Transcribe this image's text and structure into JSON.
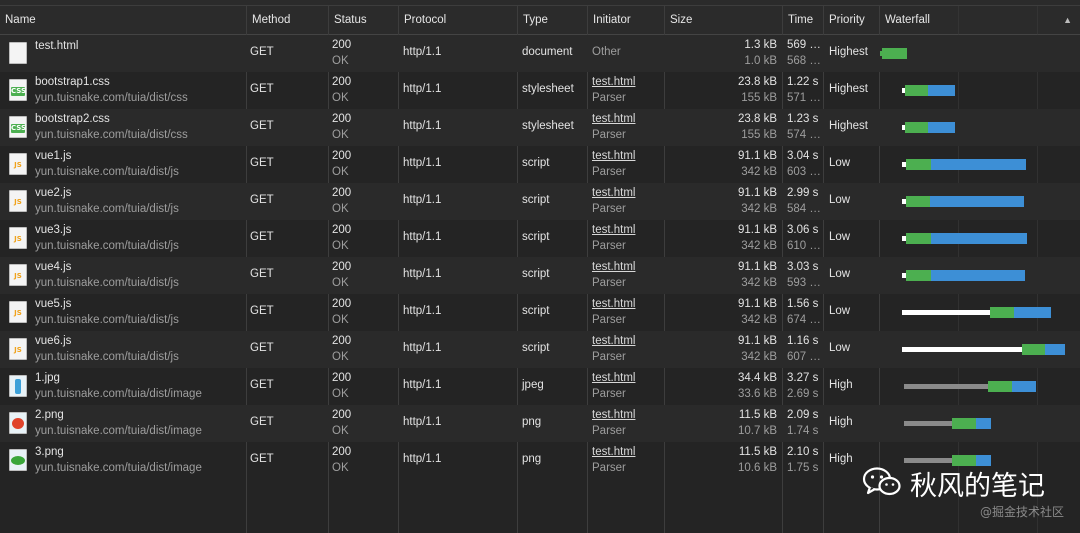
{
  "columns": [
    "Name",
    "Method",
    "Status",
    "Protocol",
    "Type",
    "Initiator",
    "Size",
    "Time",
    "Priority",
    "Waterfall"
  ],
  "sort_glyph": "▲",
  "rows": [
    {
      "name": "test.html",
      "domain": "",
      "icon": "html-file-icon",
      "method": "GET",
      "status": "200",
      "status_text": "OK",
      "protocol": "http/1.1",
      "type": "document",
      "initiator": "Other",
      "initiator_sub": "",
      "size": "1.3 kB",
      "resource": "1.0 kB",
      "time": "569 …",
      "latency": "568 …",
      "priority": "Highest",
      "waterfall": {
        "wait_start": 0,
        "wait_end": 2,
        "green_end": 27,
        "blue_end": 27,
        "wait_color": "#4caf50"
      }
    },
    {
      "name": "bootstrap1.css",
      "domain": "yun.tuisnake.com/tuia/dist/css",
      "icon": "css-file-icon",
      "method": "GET",
      "status": "200",
      "status_text": "OK",
      "protocol": "http/1.1",
      "type": "stylesheet",
      "initiator": "test.html",
      "initiator_sub": "Parser",
      "size": "23.8 kB",
      "resource": "155 kB",
      "time": "1.22 s",
      "latency": "571 …",
      "priority": "Highest",
      "waterfall": {
        "wait_start": 22,
        "wait_end": 25,
        "green_end": 48,
        "blue_end": 75,
        "wait_color": "#ffffff"
      }
    },
    {
      "name": "bootstrap2.css",
      "domain": "yun.tuisnake.com/tuia/dist/css",
      "icon": "css-file-icon",
      "method": "GET",
      "status": "200",
      "status_text": "OK",
      "protocol": "http/1.1",
      "type": "stylesheet",
      "initiator": "test.html",
      "initiator_sub": "Parser",
      "size": "23.8 kB",
      "resource": "155 kB",
      "time": "1.23 s",
      "latency": "574 …",
      "priority": "Highest",
      "waterfall": {
        "wait_start": 22,
        "wait_end": 25,
        "green_end": 48,
        "blue_end": 75,
        "wait_color": "#ffffff"
      }
    },
    {
      "name": "vue1.js",
      "domain": "yun.tuisnake.com/tuia/dist/js",
      "icon": "js-file-icon",
      "method": "GET",
      "status": "200",
      "status_text": "OK",
      "protocol": "http/1.1",
      "type": "script",
      "initiator": "test.html",
      "initiator_sub": "Parser",
      "size": "91.1 kB",
      "resource": "342 kB",
      "time": "3.04 s",
      "latency": "603 …",
      "priority": "Low",
      "waterfall": {
        "wait_start": 22,
        "wait_end": 26,
        "green_end": 51,
        "blue_end": 146,
        "wait_color": "#ffffff"
      }
    },
    {
      "name": "vue2.js",
      "domain": "yun.tuisnake.com/tuia/dist/js",
      "icon": "js-file-icon",
      "method": "GET",
      "status": "200",
      "status_text": "OK",
      "protocol": "http/1.1",
      "type": "script",
      "initiator": "test.html",
      "initiator_sub": "Parser",
      "size": "91.1 kB",
      "resource": "342 kB",
      "time": "2.99 s",
      "latency": "584 …",
      "priority": "Low",
      "waterfall": {
        "wait_start": 22,
        "wait_end": 26,
        "green_end": 50,
        "blue_end": 144,
        "wait_color": "#ffffff"
      }
    },
    {
      "name": "vue3.js",
      "domain": "yun.tuisnake.com/tuia/dist/js",
      "icon": "js-file-icon",
      "method": "GET",
      "status": "200",
      "status_text": "OK",
      "protocol": "http/1.1",
      "type": "script",
      "initiator": "test.html",
      "initiator_sub": "Parser",
      "size": "91.1 kB",
      "resource": "342 kB",
      "time": "3.06 s",
      "latency": "610 …",
      "priority": "Low",
      "waterfall": {
        "wait_start": 22,
        "wait_end": 26,
        "green_end": 51,
        "blue_end": 147,
        "wait_color": "#ffffff"
      }
    },
    {
      "name": "vue4.js",
      "domain": "yun.tuisnake.com/tuia/dist/js",
      "icon": "js-file-icon",
      "method": "GET",
      "status": "200",
      "status_text": "OK",
      "protocol": "http/1.1",
      "type": "script",
      "initiator": "test.html",
      "initiator_sub": "Parser",
      "size": "91.1 kB",
      "resource": "342 kB",
      "time": "3.03 s",
      "latency": "593 …",
      "priority": "Low",
      "waterfall": {
        "wait_start": 22,
        "wait_end": 26,
        "green_end": 51,
        "blue_end": 145,
        "wait_color": "#ffffff"
      }
    },
    {
      "name": "vue5.js",
      "domain": "yun.tuisnake.com/tuia/dist/js",
      "icon": "js-file-icon",
      "method": "GET",
      "status": "200",
      "status_text": "OK",
      "protocol": "http/1.1",
      "type": "script",
      "initiator": "test.html",
      "initiator_sub": "Parser",
      "size": "91.1 kB",
      "resource": "342 kB",
      "time": "1.56 s",
      "latency": "674 …",
      "priority": "Low",
      "waterfall": {
        "wait_start": 22,
        "wait_end": 110,
        "green_end": 134,
        "blue_end": 171,
        "wait_color": "#ffffff"
      }
    },
    {
      "name": "vue6.js",
      "domain": "yun.tuisnake.com/tuia/dist/js",
      "icon": "js-file-icon",
      "method": "GET",
      "status": "200",
      "status_text": "OK",
      "protocol": "http/1.1",
      "type": "script",
      "initiator": "test.html",
      "initiator_sub": "Parser",
      "size": "91.1 kB",
      "resource": "342 kB",
      "time": "1.16 s",
      "latency": "607 …",
      "priority": "Low",
      "waterfall": {
        "wait_start": 22,
        "wait_end": 142,
        "green_end": 165,
        "blue_end": 185,
        "wait_color": "#ffffff"
      }
    },
    {
      "name": "1.jpg",
      "domain": "yun.tuisnake.com/tuia/dist/image",
      "icon": "bottle-image-icon",
      "method": "GET",
      "status": "200",
      "status_text": "OK",
      "protocol": "http/1.1",
      "type": "jpeg",
      "initiator": "test.html",
      "initiator_sub": "Parser",
      "size": "34.4 kB",
      "resource": "33.6 kB",
      "time": "3.27 s",
      "latency": "2.69 s",
      "priority": "High",
      "waterfall": {
        "wait_start": 24,
        "wait_end": 108,
        "green_end": 132,
        "blue_end": 156,
        "wait_color": "#8a8a8a"
      }
    },
    {
      "name": "2.png",
      "domain": "yun.tuisnake.com/tuia/dist/image",
      "icon": "tomato-image-icon",
      "method": "GET",
      "status": "200",
      "status_text": "OK",
      "protocol": "http/1.1",
      "type": "png",
      "initiator": "test.html",
      "initiator_sub": "Parser",
      "size": "11.5 kB",
      "resource": "10.7 kB",
      "time": "2.09 s",
      "latency": "1.74 s",
      "priority": "High",
      "waterfall": {
        "wait_start": 24,
        "wait_end": 72,
        "green_end": 96,
        "blue_end": 111,
        "wait_color": "#8a8a8a"
      }
    },
    {
      "name": "3.png",
      "domain": "yun.tuisnake.com/tuia/dist/image",
      "icon": "leaf-image-icon",
      "method": "GET",
      "status": "200",
      "status_text": "OK",
      "protocol": "http/1.1",
      "type": "png",
      "initiator": "test.html",
      "initiator_sub": "Parser",
      "size": "11.5 kB",
      "resource": "10.6 kB",
      "time": "2.10 s",
      "latency": "1.75 s",
      "priority": "High",
      "waterfall": {
        "wait_start": 24,
        "wait_end": 72,
        "green_end": 96,
        "blue_end": 111,
        "wait_color": "#8a8a8a"
      }
    }
  ],
  "colors": {
    "waterfall_green": "#4caf50",
    "waterfall_blue": "#3d8fd6"
  },
  "watermark": {
    "title": "秋风的笔记",
    "subtitle": "@掘金技术社区"
  }
}
